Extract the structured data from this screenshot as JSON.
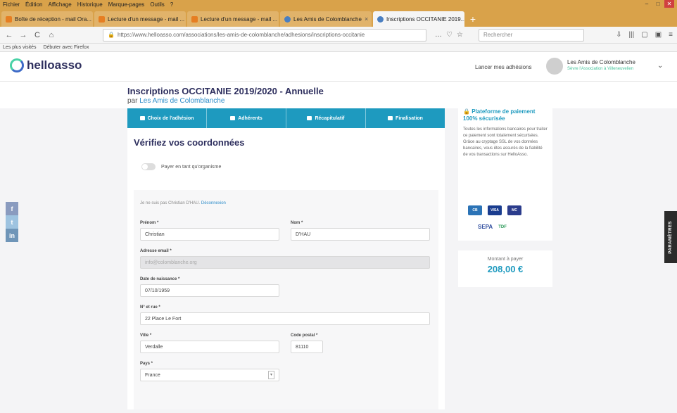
{
  "browser": {
    "menu": [
      "Fichier",
      "Édition",
      "Affichage",
      "Historique",
      "Marque-pages",
      "Outils",
      "?"
    ],
    "tabs": [
      {
        "label": "Boîte de réception - mail Ora...",
        "close": "×"
      },
      {
        "label": "Lecture d'un message - mail ...",
        "close": "×"
      },
      {
        "label": "Lecture d'un message - mail ...",
        "close": "×"
      },
      {
        "label": "Les Amis de Colomblanche",
        "close": "×"
      },
      {
        "label": "Inscriptions OCCITANIE 2019...",
        "close": "×"
      }
    ],
    "new_tab": "+",
    "url": "https://www.helloasso.com/associations/les-amis-de-colomblanche/adhesions/inscriptions-occitanie",
    "search_placeholder": "Rechercher",
    "bookmarks": [
      "Les plus visités",
      "Débuter avec Firefox"
    ],
    "nav": {
      "back": "←",
      "forward": "→",
      "reload": "C",
      "home": "⌂"
    },
    "url_icons": [
      "…",
      "♡",
      "☆"
    ],
    "right_icons": [
      "⇩",
      "|||",
      "▢",
      "▣",
      "≡"
    ],
    "window_controls": [
      "–",
      "□",
      "✕"
    ]
  },
  "header": {
    "logo": "helloasso",
    "launch": "Lancer mes adhésions",
    "account_name": "Les Amis de Colomblanche",
    "account_sub": "Sèvre l'Association à Villeneuvelien",
    "caret": "⌄"
  },
  "page": {
    "title": "Inscriptions OCCITANIE 2019/2020 - Annuelle",
    "by_prefix": "par",
    "by_org": "Les Amis de Colomblanche"
  },
  "steps": [
    "Choix de l'adhésion",
    "Adhérents",
    "Récapitulatif",
    "Finalisation"
  ],
  "form": {
    "heading": "Vérifiez vos coordonnées",
    "toggle_label": "Payer en tant qu'organisme",
    "note": "Je ne suis pas Christian D'HAU.",
    "note_link": "Déconnexion",
    "fields": {
      "firstname_label": "Prénom *",
      "firstname": "Christian",
      "lastname_label": "Nom *",
      "lastname": "D'HAU",
      "email_label": "Adresse email *",
      "email": "info@colomblanche.org",
      "birth_label": "Date de naissance *",
      "birth": "07/10/1959",
      "street_label": "N° et rue *",
      "street": "22 Place Le Fort",
      "city_label": "Ville *",
      "city": "Verdalle",
      "zip_label": "Code postal *",
      "zip": "81110",
      "country_label": "Pays *",
      "country": "France"
    }
  },
  "secure": {
    "title": "Plateforme de paiement 100% sécurisée",
    "text": "Toutes les informations bancaires pour traiter ce paiement sont totalement sécurisées. Grâce au cryptage SSL de vos données bancaires, vous êtes assurés de la fiabilité de vos transactions sur HelloAsso.",
    "cards": [
      "CB",
      "VISA",
      "MC"
    ],
    "sepa": "SEPA",
    "tdf": "TDF"
  },
  "amount": {
    "label": "Montant à payer",
    "value": "208,00 €"
  },
  "social": {
    "facebook": "f",
    "twitter": "t",
    "linkedin": "in"
  },
  "params_label": "PARAMÈTRES",
  "colors": {
    "accent": "#1e9abf",
    "brand": "#2e2f5e",
    "tab_bar": "#d9a24a"
  }
}
